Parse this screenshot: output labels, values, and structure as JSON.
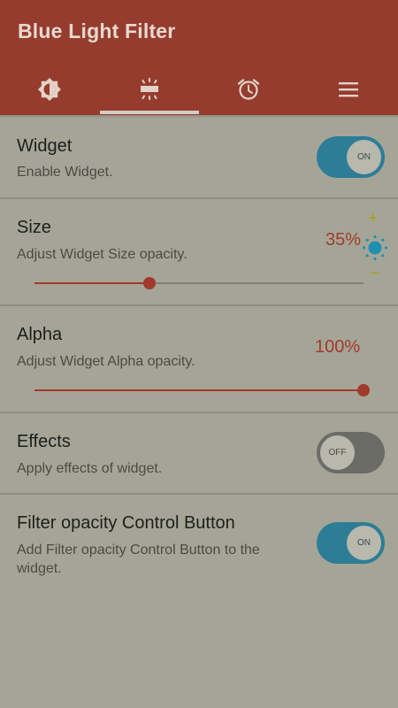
{
  "app": {
    "title": "Blue Light Filter"
  },
  "tabs": [
    {
      "icon": "brightness-icon"
    },
    {
      "icon": "widget-icon",
      "selected": true
    },
    {
      "icon": "alarm-clock-icon"
    },
    {
      "icon": "menu-icon"
    }
  ],
  "settings": {
    "widget": {
      "title": "Widget",
      "description": "Enable Widget.",
      "toggle_label": "ON",
      "enabled": true
    },
    "size": {
      "title": "Size",
      "description": "Adjust Widget Size opacity.",
      "value_label": "35%",
      "value": 35
    },
    "alpha": {
      "title": "Alpha",
      "description": "Adjust Widget Alpha opacity.",
      "value_label": "100%",
      "value": 100
    },
    "effects": {
      "title": "Effects",
      "description": "Apply effects of widget.",
      "toggle_label": "OFF",
      "enabled": false
    },
    "filter_button": {
      "title": "Filter opacity Control Button",
      "description": "Add Filter opacity Control Button to the widget.",
      "toggle_label": "ON",
      "enabled": true
    }
  },
  "floating_control": {
    "plus_label": "+",
    "minus_label": "−",
    "icon": "brightness-sun-icon"
  },
  "colors": {
    "appbar": "#963c2e",
    "accent": "#a13a2c",
    "toggle_on": "#2d7d96",
    "background": "#a5a597"
  }
}
